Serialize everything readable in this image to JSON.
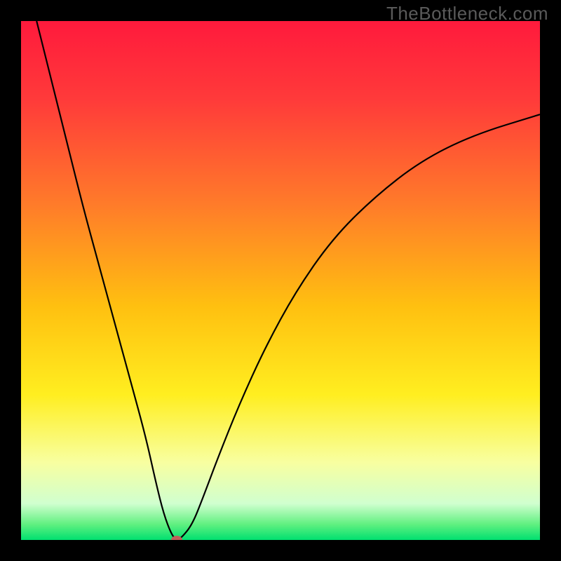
{
  "watermark": "TheBottleneck.com",
  "chart_data": {
    "type": "line",
    "title": "",
    "xlabel": "",
    "ylabel": "",
    "xlim": [
      0,
      100
    ],
    "ylim": [
      0,
      100
    ],
    "background": {
      "type": "vertical-gradient",
      "stops": [
        {
          "pos": 0.0,
          "color": "#ff1a3c"
        },
        {
          "pos": 0.15,
          "color": "#ff3a3a"
        },
        {
          "pos": 0.35,
          "color": "#ff7a2a"
        },
        {
          "pos": 0.55,
          "color": "#ffc010"
        },
        {
          "pos": 0.72,
          "color": "#ffee20"
        },
        {
          "pos": 0.85,
          "color": "#f8ffa0"
        },
        {
          "pos": 0.93,
          "color": "#d0ffcf"
        },
        {
          "pos": 0.97,
          "color": "#60f080"
        },
        {
          "pos": 1.0,
          "color": "#00e070"
        }
      ]
    },
    "series": [
      {
        "name": "bottleneck-curve",
        "color": "#000000",
        "width": 2.2,
        "x": [
          3,
          6,
          9,
          12,
          15,
          18,
          21,
          24,
          26,
          27.5,
          29,
          30,
          31,
          33,
          35,
          38,
          42,
          47,
          53,
          60,
          68,
          77,
          87,
          100
        ],
        "y": [
          100,
          88,
          76,
          64,
          53,
          42,
          31,
          20,
          11,
          5,
          1,
          0,
          0.5,
          3,
          8,
          16,
          26,
          37,
          48,
          58,
          66,
          73,
          78,
          82
        ]
      }
    ],
    "marker": {
      "name": "optimum-point",
      "x": 30,
      "y": 0,
      "color": "#c0605a",
      "rx": 8,
      "ry": 6
    }
  }
}
